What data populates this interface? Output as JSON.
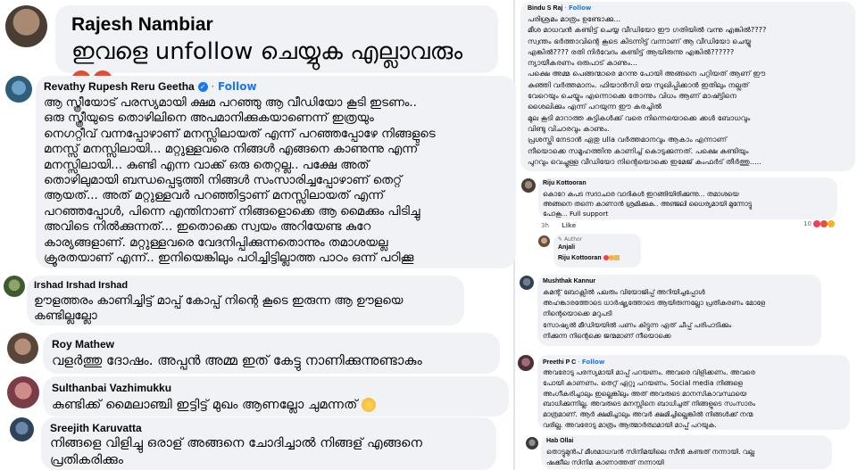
{
  "comments_left": [
    {
      "name": "Rajesh Nambiar",
      "text": "ഇവളെ unfollow ചെയ്യുക എല്ലാവരും",
      "emoji": "angry-face-icon"
    },
    {
      "name": "Revathy Rupesh Reru Geetha",
      "verified": "verified-badge-icon",
      "follow": "Follow",
      "text": "ആ സ്ത്രീയോട് പരസ്യമായി ക്ഷമ പറഞ്ഞു ആ വീഡിയോ കൂടി ഇടണം..\nഒരു സ്ത്രീയുടെ തൊഴിലിനെ അപമാനിക്കുകയാണെന്ന് ഇത്രയും\nനെഗറ്റീവ് വന്നപ്പോഴാണ് മനസ്സിലായത് എന്ന് പറഞ്ഞപ്പോഴേ നിങ്ങളുടെ\nമനസ്സ് മനസ്സിലായി... മറ്റുള്ളവരെ നിങ്ങൾ എങ്ങനെ കാണുന്നു എന്ന്\nമനസ്സിലായി... കുണ്ടി എന്ന വാക്ക് ഒരു തെറ്റല്ല.. പക്ഷേ അത്\nതൊഴിലുമായി ബന്ധപ്പെടുത്തി നിങ്ങൾ സംസാരിച്ചപ്പോഴാണ് തെറ്റ്\nആയത്... അത് മറ്റുള്ളവർ പറഞ്ഞിട്ടാണ് മനസ്സിലായത് എന്ന്\nപറഞ്ഞപ്പോൾ, പിന്നെ എന്തിനാണ് നിങ്ങളൊക്കെ ആ മൈക്കും പിടിച്ചു\nഅവിടെ നിൽക്കുന്നത്... ഇതൊക്കെ സ്വയം അറിയേണ്ട കുറേ\nകാര്യങ്ങളാണ്. മറ്റുള്ളവരെ വേദനിപ്പിക്കുന്നതൊന്നും തമാശയല്ല\nക്രൂരതയാണ് എന്ന്.. ഇനിയെങ്കിലും പഠിച്ചിട്ടില്ലാത്ത പാഠം ഒന്ന് പഠിക്കൂ"
    },
    {
      "name": "Irshad Irshad Irshad",
      "text": "ഊളത്തരം കാണിച്ചിട്ട് മാപ്പ് കോപ്പ് നിന്റെ കൂടെ ഇരുന്ന ആ ഊളയെ\nകണ്ടില്ലല്ലോ"
    },
    {
      "name": "Roy Mathew",
      "text": "വളർത്തു ദോഷം. അപ്പൻ അമ്മ ഇത് കേട്ടു നാണിക്കുന്നുണ്ടാകും"
    },
    {
      "name": "Sulthanbai Vazhimukku",
      "text": "കുണ്ടിക്ക് മൈലാഞ്ചി ഇട്ടിട്ട് മുഖം ആണല്ലോ ചുമന്നത്",
      "emoji": "rolling-eyes-icon"
    },
    {
      "name": "Sreejith Karuvatta",
      "text": "നിങ്ങളെ വിളിച്ചു ഒരാള് അങ്ങനെ ചോദിച്ചാൽ നിങ്ങള് എങ്ങനെ\nപ്രതികരിക്കും"
    }
  ],
  "comments_right": [
    {
      "name": "Bindu S Raj",
      "follow": "Follow",
      "text": "പരിശ്രമം മാത്രം ഉണ്ടോക്കു...\nമീശ മാധവൻ കണ്ടിട്ട് ചെയ്യ വീഡിയോ ഈ ഗതിയിൽ വന്നു എങ്കിൽ????\nസ്വന്തം ഭർത്താവിന്റെ കൂടെ കിടന്നിട്ട് വന്നാണ് ആ വീഡിയോ ചെയ്യു\nഎങ്കിൽ???? രതി നിർവേദം കണ്ടിട്ട് ആയിരുന്നു എങ്കിൽ??????\nന്യായീകരണം ഒരുപാട് കാണും...\nപക്ഷെ അമ്മ പെങ്ങന്മാരെ മറന്നു പോയി അങ്ങനെ പറ്റിയത് ആണ് ഈ\nകുഞ്ഞി വർത്തമാനം. ഫിയാൻസി യേ സുഖിപ്പിക്കാൻ ഇതിലും നല്ലത്\nവേറെയും ചെയ്യും എന്നൊക്കെ തോന്നും വിധം ആണ് മാഷ്ട്ടിനെ\nശൈലിക്കും എന്ന് പറയുന്ന ഈ കരച്ചിൽ\nമുല കൂടി മാറാത്ത കുട്ടികൾക്ക് വരെ നിന്നെയൊക്കെ ക്കൾ ബോധവും\nവിണ്ടു വിചാരവും കാണും.\nപ്രശസ്തി നേടാൻ ഏതു ulla വർത്തമാനവും ആകാം എന്നാണ്\nനീയൊക്കെ സമൂഹത്തിനു കാണിച്ച് കൊടുക്കുന്നത്. പക്ഷെ കുണ്ടിയും\nപുറവും വെച്ചുള്ള വീഡിയോ നിന്റെയൊക്കെ ഇമേജ് കംഫർട് തീർത്തു....."
    },
    {
      "name": "Riju Kottooran",
      "text": "കൊറേ കപട സദാചാര വാദികൾ ഇറങ്ങിയിരിക്കുന്നു... തമാശയെ\nഅങ്ങനെ തന്നെ കാണാൻ ശ്രമിക്കുക.. അഞ്ജലി ധൈര്യമായി മുന്നോട്ടു\nപോകൂ... Full support",
      "time": "3h",
      "like": "Like",
      "reactions": "10"
    },
    {
      "author": "Author",
      "name": "Anjali",
      "text": "Riju Kottooran"
    },
    {
      "name": "Mushthak Kannur",
      "text": "കമന്റ് ബോക്സിൽ പലരും വിയോജിപ്പ് അറിയിച്ചപ്പോൾ\nഅഹങ്കാരത്തോടെ ധാർഷ്ട്യത്തോടെ ആയിരുന്നല്ലോ പ്രതികരണം മോളേ\nനിന്റെയൊക്കെ മറുപടി\nസോഷ്യൽ മീഡിയയിൽ പണം കിട്ടുന്ന ഏത് ചീപ്പ് പരിപാടിക്കും\nനിക്കുന്ന നിന്റെക്കെ ജന്മമാണ് നീയൊക്കെ"
    },
    {
      "name": "Preethi P C",
      "follow": "Follow",
      "text": "അവരോടു പരസ്യമായി മാപ്പ് പറയണം. അവരെ വിളിക്കണം. അവരെ\nപോയി കാണണം. തെറ്റ് ഏറ്റു പറയണം. Social media നിങ്ങളെ\nഅംഗീകരിച്ചാലും ഇല്ലെങ്കിലും അത് അവരുടെ മാനസികാവസ്ഥയെ\nബാധിക്കുന്നില്ല. അവരുടെ മനസ്സിനെ ബാധിച്ചത് നിങ്ങളുടെ സംസാരം\nമാത്രമാണ്. ആർ ക്ഷമിച്ചാലും അവർ ക്ഷമിച്ചില്ലെങ്കിൽ നിങ്ങൾക്ക് നന്മ\nവരില്ല. അവരോടു മാത്രം ആത്മാർത്ഥമായി മാപ്പ് പറയുക."
    },
    {
      "name": "Hab Ollai",
      "text": "തൊട്ടുമുൻപ് മീശമാധവൻ സിനിമയിലെ സീൻ കണ്ടത് നന്നായി. വല്ല\nഷക്കീല സിനിമ കാണാത്തത് നന്നായി"
    }
  ],
  "colors": {
    "bubble": "#f0f2f5",
    "follow": "#1877f2",
    "text": "#050505",
    "reaction_angry": "#e4523c",
    "reaction_love": "#f33e58"
  }
}
